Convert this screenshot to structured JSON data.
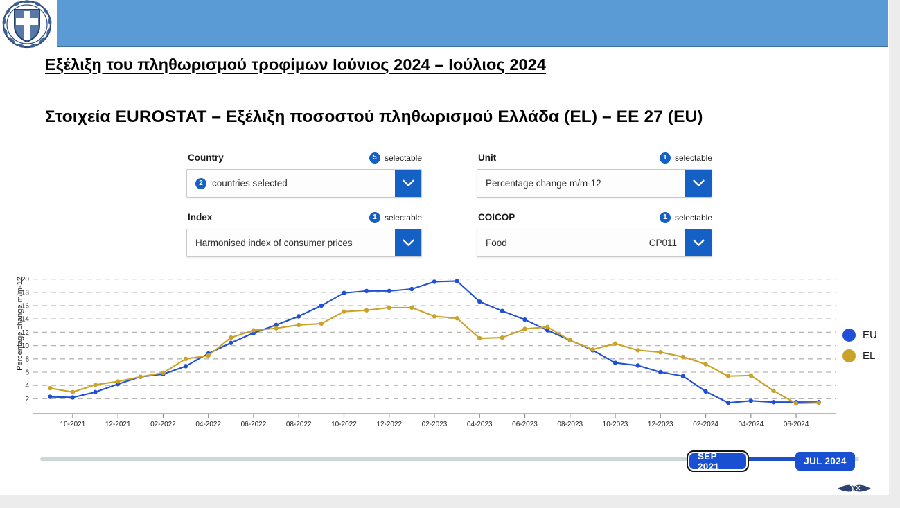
{
  "header": {
    "emblem_icon": "greek-coat-of-arms-icon",
    "band_color": "#5b9bd5"
  },
  "titles": {
    "main": "Εξέλιξη του πληθωρισμού τροφίμων Ιούνιος 2024 – Ιούλιος 2024",
    "sub": "Στοιχεία EUROSTAT – Εξέλιξη ποσοστού πληθωρισμού Ελλάδα (EL) – ΕΕ 27 (EU)"
  },
  "selectors": [
    {
      "key": "country",
      "label": "Country",
      "selectable_count": "5",
      "selectable_text": "selectable",
      "value_badge": "2",
      "value": "countries selected",
      "code": "",
      "chevron_icon": "chevron-down-icon"
    },
    {
      "key": "unit",
      "label": "Unit",
      "selectable_count": "1",
      "selectable_text": "selectable",
      "value_badge": "",
      "value": "Percentage change m/m-12",
      "code": "",
      "chevron_icon": "chevron-down-icon"
    },
    {
      "key": "index",
      "label": "Index",
      "selectable_count": "1",
      "selectable_text": "selectable",
      "value_badge": "",
      "value": "Harmonised index of consumer prices",
      "code": "",
      "chevron_icon": "chevron-down-icon"
    },
    {
      "key": "coicop",
      "label": "COICOP",
      "selectable_count": "1",
      "selectable_text": "selectable",
      "value_badge": "",
      "value": "Food",
      "code": "CP011",
      "chevron_icon": "chevron-down-icon"
    }
  ],
  "legend": [
    {
      "label": "EU",
      "color": "#1f4ed8"
    },
    {
      "label": "EL",
      "color": "#c9a227"
    }
  ],
  "timeline": {
    "start_label": "SEP 2021",
    "end_label": "JUL 2024"
  },
  "chart_data": {
    "type": "line",
    "title": "",
    "xlabel": "",
    "ylabel": "Percentage change m/m-12",
    "ylim": [
      1,
      21
    ],
    "yticks": [
      2,
      4,
      6,
      8,
      10,
      12,
      14,
      16,
      18,
      20
    ],
    "grid": true,
    "legend_position": "right",
    "x": [
      "09-2021",
      "10-2021",
      "11-2021",
      "12-2021",
      "01-2022",
      "02-2022",
      "03-2022",
      "04-2022",
      "05-2022",
      "06-2022",
      "07-2022",
      "08-2022",
      "09-2022",
      "10-2022",
      "11-2022",
      "12-2022",
      "01-2023",
      "02-2023",
      "03-2023",
      "04-2023",
      "05-2023",
      "06-2023",
      "07-2023",
      "08-2023",
      "09-2023",
      "10-2023",
      "11-2023",
      "12-2023",
      "01-2024",
      "02-2024",
      "03-2024",
      "04-2024",
      "05-2024",
      "06-2024",
      "07-2024"
    ],
    "xtick_labels": [
      "10-2021",
      "12-2021",
      "02-2022",
      "04-2022",
      "06-2022",
      "08-2022",
      "10-2022",
      "12-2022",
      "02-2023",
      "04-2023",
      "06-2023",
      "08-2023",
      "10-2023",
      "12-2023",
      "02-2024",
      "04-2024",
      "06-2024"
    ],
    "series": [
      {
        "name": "EU",
        "color": "#1f4ed8",
        "values": [
          2.3,
          2.2,
          3.0,
          4.2,
          5.3,
          5.7,
          6.9,
          8.8,
          10.4,
          11.9,
          13.1,
          14.4,
          16.0,
          17.9,
          18.2,
          18.2,
          18.5,
          19.6,
          19.7,
          16.6,
          15.2,
          13.9,
          12.3,
          10.8,
          9.3,
          7.4,
          7.0,
          6.0,
          5.4,
          3.1,
          1.4,
          1.7,
          1.5,
          1.5,
          1.5
        ]
      },
      {
        "name": "EL",
        "color": "#c9a227",
        "values": [
          3.6,
          3.0,
          4.1,
          4.6,
          5.3,
          5.9,
          8.0,
          8.5,
          11.2,
          12.3,
          12.6,
          13.1,
          13.3,
          15.1,
          15.3,
          15.7,
          15.7,
          14.4,
          14.1,
          11.1,
          11.2,
          12.5,
          12.8,
          10.8,
          9.4,
          10.3,
          9.3,
          9.0,
          8.3,
          7.2,
          5.4,
          5.5,
          3.2,
          1.3,
          1.4
        ]
      }
    ]
  }
}
